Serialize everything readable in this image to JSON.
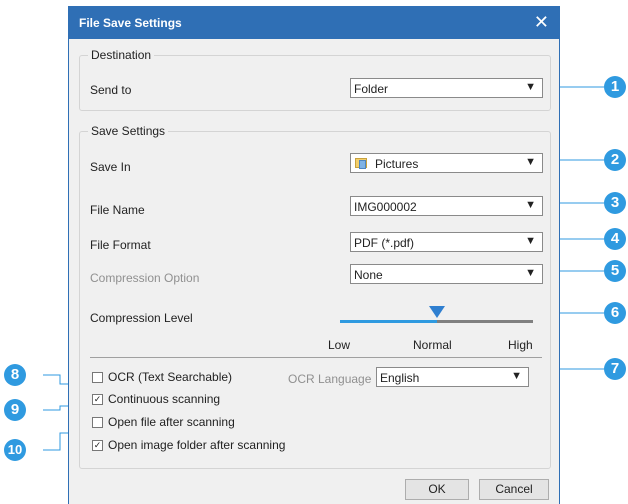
{
  "dialog": {
    "title": "File Save Settings",
    "close_icon": "close-icon"
  },
  "destination": {
    "legend": "Destination",
    "send_to_label": "Send to",
    "send_to_value": "Folder"
  },
  "save_settings": {
    "legend": "Save Settings",
    "save_in_label": "Save In",
    "save_in_value": "Pictures",
    "file_name_label": "File Name",
    "file_name_value": "IMG000002",
    "file_format_label": "File Format",
    "file_format_value": "PDF (*.pdf)",
    "compression_option_label": "Compression Option",
    "compression_option_value": "None",
    "compression_level_label": "Compression Level",
    "slider_low": "Low",
    "slider_normal": "Normal",
    "slider_high": "High",
    "slider_level": 0.5
  },
  "ocr": {
    "checkbox_label": "OCR (Text Searchable)",
    "checked": false,
    "language_label": "OCR Language",
    "language_value": "English"
  },
  "options": [
    {
      "label": "Continuous scanning",
      "checked": true
    },
    {
      "label": "Open file after scanning",
      "checked": false
    },
    {
      "label": "Open image folder after scanning",
      "checked": true
    }
  ],
  "buttons": {
    "ok": "OK",
    "cancel": "Cancel"
  },
  "callouts": [
    "1",
    "2",
    "3",
    "4",
    "5",
    "6",
    "7",
    "8",
    "9",
    "10"
  ],
  "colors": {
    "titlebar": "#2f6fb5",
    "callout": "#2f9ae0",
    "slider_active": "#2f9ae0",
    "slider_inactive": "#808080"
  },
  "arrow_glyph": "▼",
  "check_glyph": "✓"
}
